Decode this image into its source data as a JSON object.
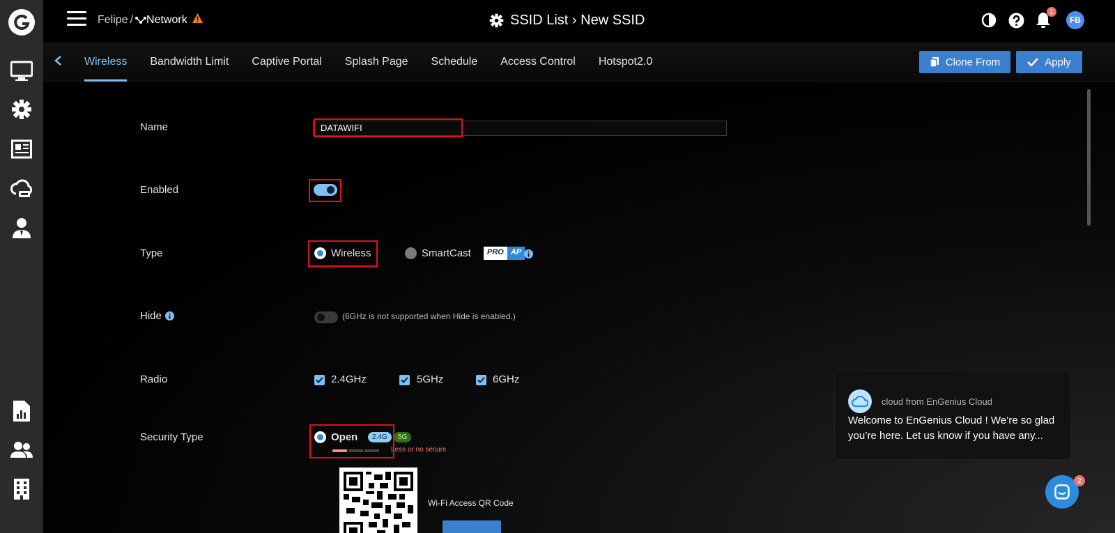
{
  "header": {
    "user": "Felipe",
    "separator": "/",
    "network": "Network",
    "title": "SSID List › New SSID",
    "notification_count": "1",
    "avatar_initials": "FB"
  },
  "tabs": [
    {
      "label": "Wireless",
      "active": true
    },
    {
      "label": "Bandwidth Limit"
    },
    {
      "label": "Captive Portal"
    },
    {
      "label": "Splash Page"
    },
    {
      "label": "Schedule"
    },
    {
      "label": "Access Control"
    },
    {
      "label": "Hotspot2.0"
    }
  ],
  "actions": {
    "clone_label": "Clone From",
    "apply_label": "Apply"
  },
  "form": {
    "name_label": "Name",
    "name_value": "DATAWIFI",
    "enabled_label": "Enabled",
    "enabled": true,
    "type_label": "Type",
    "type_options": [
      "Wireless",
      "SmartCast"
    ],
    "type_selected": "Wireless",
    "proap_pro": "PRO",
    "proap_ap": "AP",
    "hide_label": "Hide",
    "hide_enabled": false,
    "hide_hint": "(6GHz is not supported when Hide is enabled.)",
    "radio_label": "Radio",
    "radio_options": [
      "2.4GHz",
      "5GHz",
      "6GHz"
    ],
    "security_label": "Security Type",
    "security_selected": "Open",
    "security_badge_24": "2.4G",
    "security_badge_5": "5G",
    "security_note": "Less or no secure",
    "qr_label": "Wi-Fi Access QR Code"
  },
  "chat": {
    "from": "cloud from EnGenius Cloud",
    "message": "Welcome to EnGenius Cloud ! We’re so glad you’re here. Let us know if you have any...",
    "unread_count": "2"
  },
  "colors": {
    "accent": "#7ec0f3",
    "button": "#3b7fcf",
    "highlight": "#e0101c",
    "warning": "#f07b1f"
  }
}
